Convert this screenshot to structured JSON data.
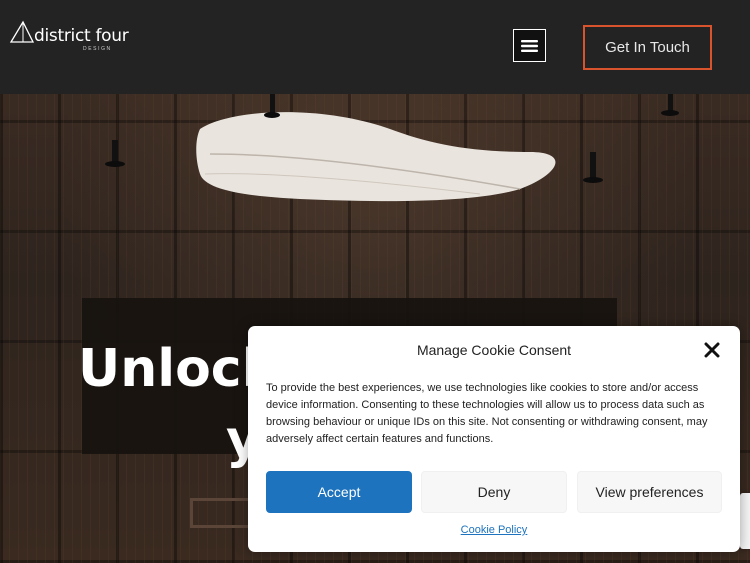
{
  "header": {
    "logo_text": "district four",
    "logo_sub": "DESIGN",
    "menu_icon": "hamburger-icon",
    "cta_label": "Get In Touch",
    "background": "#232323",
    "accent": "#d9532c"
  },
  "hero": {
    "title_line1": "Unlock",
    "title_line2": "y"
  },
  "cookie": {
    "title": "Manage Cookie Consent",
    "close_icon": "close-icon",
    "body": "To provide the best experiences, we use technologies like cookies to store and/or access device information. Consenting to these technologies will allow us to process data such as browsing behaviour or unique IDs on this site. Not consenting or withdrawing consent, may adversely affect certain features and functions.",
    "accept_label": "Accept",
    "deny_label": "Deny",
    "preferences_label": "View preferences",
    "policy_link": "Cookie Policy",
    "accept_color": "#1e73be"
  }
}
